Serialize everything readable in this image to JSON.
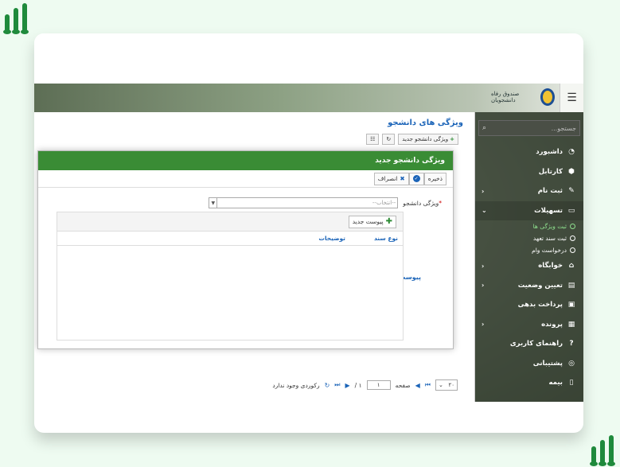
{
  "app": {
    "brand_text": "صندوق رفاه دانشجویان"
  },
  "sidebar": {
    "search_placeholder": "جستجو...",
    "items": [
      {
        "label": "داشبورد",
        "icon": "dashboard-icon",
        "glyph": "◔",
        "chevron": ""
      },
      {
        "label": "کارتابل",
        "icon": "box-icon",
        "glyph": "⬢",
        "chevron": ""
      },
      {
        "label": "ثبت نام",
        "icon": "edit-icon",
        "glyph": "✎",
        "chevron": "‹"
      },
      {
        "label": "تسهیلات",
        "icon": "card-icon",
        "glyph": "▭",
        "chevron": "⌄"
      },
      {
        "label": "خوابگاه",
        "icon": "home-icon",
        "glyph": "⌂",
        "chevron": "‹"
      },
      {
        "label": "تعیین وضعیت",
        "icon": "book-icon",
        "glyph": "▤",
        "chevron": "‹"
      },
      {
        "label": "پرداخت بدهی",
        "icon": "money-icon",
        "glyph": "▣",
        "chevron": ""
      },
      {
        "label": "پرونده",
        "icon": "folder-icon",
        "glyph": "▦",
        "chevron": "‹"
      },
      {
        "label": "راهنمای کاربری",
        "icon": "help-icon",
        "glyph": "?",
        "chevron": ""
      },
      {
        "label": "پشتیبانی",
        "icon": "globe-icon",
        "glyph": "◎",
        "chevron": ""
      },
      {
        "label": "بیمه",
        "icon": "doc-icon",
        "glyph": "▯",
        "chevron": ""
      }
    ],
    "subitems": [
      {
        "label": "ثبت ویژگی ها",
        "active": true
      },
      {
        "label": "ثبت سند تعهد",
        "active": false
      },
      {
        "label": "درخواست وام",
        "active": false
      }
    ]
  },
  "panel": {
    "title": "ویژگی های دانشجو",
    "new_label": "ویژگی دانشجو جدید"
  },
  "dialog": {
    "title": "ویژگی دانشجو جدید",
    "save_label": "ذخیره",
    "cancel_label": "انصراف",
    "field_label": "ویژگی دانشجو",
    "select_placeholder": "--انتخاب--",
    "attach_label": "پیوست",
    "add_attachment_label": "پیوست جدید",
    "columns": [
      "نوع سند",
      "توضیحات"
    ]
  },
  "pager": {
    "page_size": "۲۰",
    "page_label": "صفحه",
    "page_value": "۱",
    "page_total": "۱ /",
    "empty_text": "رکوردی وجود ندارد"
  }
}
